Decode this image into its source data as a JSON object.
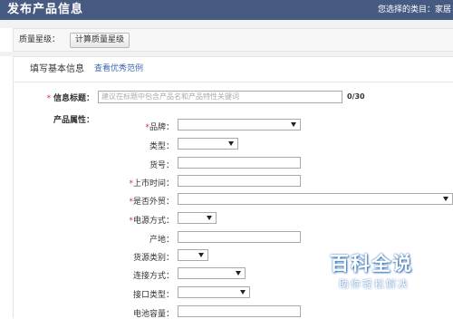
{
  "header": {
    "title": "发布产品信息",
    "selected_category": "您选择的类目：家居"
  },
  "quality": {
    "label": "质量星级：",
    "button": "计算质量星级"
  },
  "panel": {
    "title": "填写基本信息",
    "link": "查看优秀范例"
  },
  "info_title": {
    "star": "*",
    "label": "信息标题：",
    "placeholder": "建议在标题中包含产品名和产品特性关键词",
    "counter": "0/30"
  },
  "attributes_label": "产品属性：",
  "fields": [
    {
      "star": "*",
      "label": "品牌：",
      "type": "select"
    },
    {
      "star": "",
      "label": "类型：",
      "type": "select"
    },
    {
      "star": "",
      "label": "货号：",
      "type": "input"
    },
    {
      "star": "*",
      "label": "上市时间：",
      "type": "input"
    },
    {
      "star": "*",
      "label": "是否外贸：",
      "type": "select"
    },
    {
      "star": "*",
      "label": "电源方式：",
      "type": "select"
    },
    {
      "star": "",
      "label": "产地：",
      "type": "input"
    },
    {
      "star": "",
      "label": "货源类别：",
      "type": "select"
    },
    {
      "star": "",
      "label": "连接方式：",
      "type": "select"
    },
    {
      "star": "",
      "label": "接口类型：",
      "type": "select"
    },
    {
      "star": "",
      "label": "电池容量：",
      "type": "input"
    }
  ],
  "watermark": {
    "big": "百科全说",
    "small": "助你轻松解决"
  }
}
